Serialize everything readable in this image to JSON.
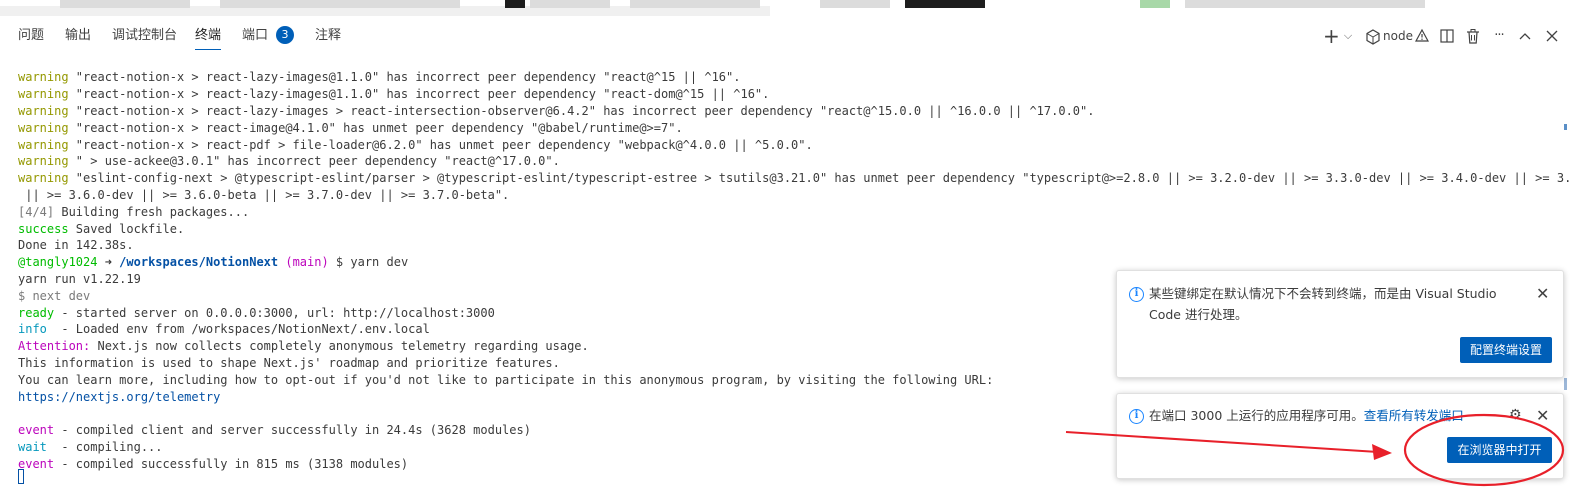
{
  "tabs": [
    {
      "label": "问题"
    },
    {
      "label": "输出"
    },
    {
      "label": "调试控制台"
    },
    {
      "label": "终端"
    },
    {
      "label": "端口"
    },
    {
      "label": "注释"
    }
  ],
  "ports_badge": "3",
  "actions": {
    "add": "+",
    "dropdown": "⌵",
    "shell_label": "node",
    "more": "···"
  },
  "terminal": {
    "lines": [
      {
        "kw": "warning",
        "text": " \"react-notion-x > react-lazy-images@1.1.0\" has incorrect peer dependency \"react@^15 || ^16\"."
      },
      {
        "kw": "warning",
        "text": " \"react-notion-x > react-lazy-images@1.1.0\" has incorrect peer dependency \"react-dom@^15 || ^16\"."
      },
      {
        "kw": "warning",
        "text": " \"react-notion-x > react-lazy-images > react-intersection-observer@6.4.2\" has incorrect peer dependency \"react@^15.0.0 || ^16.0.0 || ^17.0.0\"."
      },
      {
        "kw": "warning",
        "text": " \"react-notion-x > react-image@4.1.0\" has unmet peer dependency \"@babel/runtime@>=7\"."
      },
      {
        "kw": "warning",
        "text": " \"react-notion-x > react-pdf > file-loader@6.2.0\" has unmet peer dependency \"webpack@^4.0.0 || ^5.0.0\"."
      },
      {
        "kw": "warning",
        "text": " \" > use-ackee@3.0.1\" has incorrect peer dependency \"react@^17.0.0\"."
      },
      {
        "kw": "warning",
        "text": " \"eslint-config-next > @typescript-eslint/parser > @typescript-eslint/typescript-estree > tsutils@3.21.0\" has unmet peer dependency \"typescript@>=2.8.0 || >= 3.2.0-dev || >= 3.3.0-dev || >= 3.4.0-dev || >= 3.5.0-dev"
      },
      {
        "kw": "",
        "text": " || >= 3.6.0-dev || >= 3.6.0-beta || >= 3.7.0-dev || >= 3.7.0-beta\"."
      },
      {
        "kw": "[4/4]",
        "text": " Building fresh packages..."
      },
      {
        "kw": "success",
        "text": " Saved lockfile."
      },
      {
        "kw": "",
        "text": "Done in 142.38s."
      }
    ],
    "prompt": {
      "user": "@tangly1024",
      "arrow": " ➜ ",
      "path": "/workspaces/NotionNext",
      "branch": " (main)",
      "cmd": " $ yarn dev"
    },
    "lines2": [
      {
        "kw": "",
        "text": "yarn run v1.22.19"
      },
      {
        "kw": "",
        "text": "$ next dev"
      },
      {
        "kw": "ready",
        "text": " - started server on 0.0.0.0:3000, url: http://localhost:3000"
      },
      {
        "kw": "info",
        "text": "  - Loaded env from /workspaces/NotionNext/.env.local"
      },
      {
        "kw": "Attention:",
        "text": " Next.js now collects completely anonymous telemetry regarding usage."
      },
      {
        "kw": "",
        "text": "This information is used to shape Next.js' roadmap and prioritize features."
      },
      {
        "kw": "",
        "text": "You can learn more, including how to opt-out if you'd not like to participate in this anonymous program, by visiting the following URL:"
      },
      {
        "kw": "",
        "text": "https://nextjs.org/telemetry"
      },
      {
        "kw": "",
        "text": ""
      },
      {
        "kw": "event",
        "text": " - compiled client and server successfully in 24.4s (3628 modules)"
      },
      {
        "kw": "wait",
        "text": "  - compiling..."
      },
      {
        "kw": "event",
        "text": " - compiled successfully in 815 ms (3138 modules)"
      }
    ]
  },
  "notifications": [
    {
      "message_line1": "某些键绑定在默认情况下不会转到终端，而是由 Visual Studio",
      "message_line2": "Code 进行处理。",
      "button": "配置终端设置"
    },
    {
      "message": "在端口 3000 上运行的应用程序可用。",
      "link": "查看所有转发端口",
      "button": "在浏览器中打开"
    }
  ],
  "colors": {
    "accent": "#005fb8",
    "annotation": "#e8202a"
  }
}
